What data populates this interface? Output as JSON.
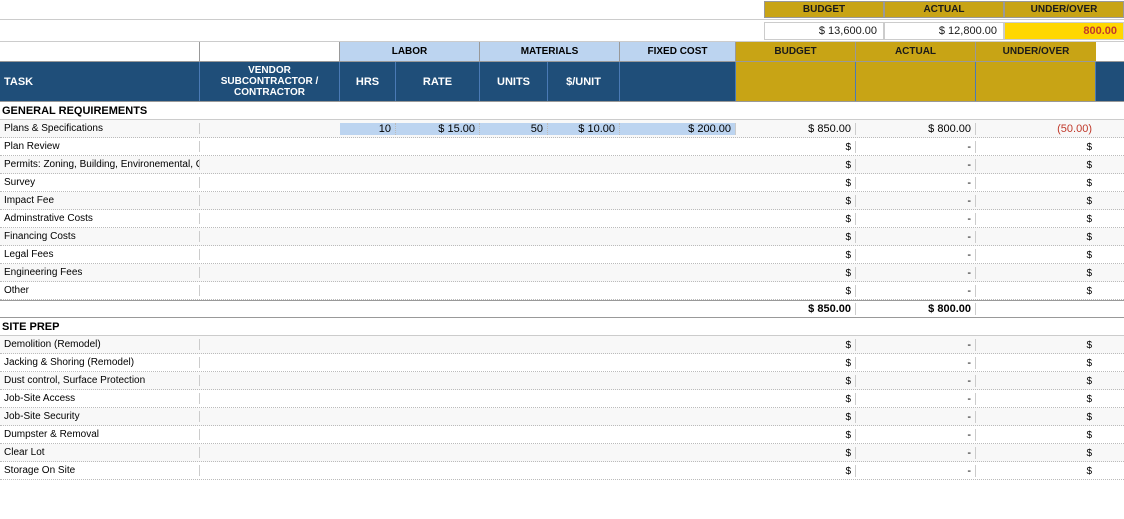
{
  "header": {
    "budget_label": "BUDGET",
    "actual_label": "ACTUAL",
    "underover_label": "UNDER/OVER",
    "budget_value": "$ 13,600.00",
    "actual_value": "$ 12,800.00",
    "underover_value": "800.00"
  },
  "col_headers": {
    "labor": "LABOR",
    "materials": "MATERIALS",
    "fixed_cost": "FIXED COST",
    "budget": "BUDGET",
    "actual": "ACTUAL",
    "underover": "UNDER/OVER"
  },
  "sub_headers": {
    "task": "TASK",
    "vendor": "VENDOR",
    "subcontractor": "SUBCONTRACTOR /",
    "contractor": "CONTRACTOR",
    "hrs": "HRS",
    "rate": "RATE",
    "units": "UNITS",
    "perunit": "$/UNIT"
  },
  "sections": [
    {
      "title": "GENERAL REQUIREMENTS",
      "rows": [
        {
          "task": "Plans & Specifications",
          "vendor": "",
          "hrs": "10",
          "rate": "$ 15.00",
          "units": "50",
          "perunit": "$ 10.00",
          "fixed": "$ 200.00",
          "budget": "$ 850.00",
          "actual": "$ 800.00",
          "underover": "(50.00)"
        },
        {
          "task": "Plan Review",
          "vendor": "",
          "hrs": "",
          "rate": "",
          "units": "",
          "perunit": "",
          "fixed": "",
          "budget": "$",
          "actual": "-",
          "underover": "$"
        },
        {
          "task": "Permits: Zoning, Building, Environemental, Other",
          "vendor": "",
          "hrs": "",
          "rate": "",
          "units": "",
          "perunit": "",
          "fixed": "",
          "budget": "$",
          "actual": "-",
          "underover": "$"
        },
        {
          "task": "Survey",
          "vendor": "",
          "hrs": "",
          "rate": "",
          "units": "",
          "perunit": "",
          "fixed": "",
          "budget": "$",
          "actual": "-",
          "underover": "$"
        },
        {
          "task": "Impact Fee",
          "vendor": "",
          "hrs": "",
          "rate": "",
          "units": "",
          "perunit": "",
          "fixed": "",
          "budget": "$",
          "actual": "-",
          "underover": "$"
        },
        {
          "task": "Adminstrative Costs",
          "vendor": "",
          "hrs": "",
          "rate": "",
          "units": "",
          "perunit": "",
          "fixed": "",
          "budget": "$",
          "actual": "-",
          "underover": "$"
        },
        {
          "task": "Financing Costs",
          "vendor": "",
          "hrs": "",
          "rate": "",
          "units": "",
          "perunit": "",
          "fixed": "",
          "budget": "$",
          "actual": "-",
          "underover": "$"
        },
        {
          "task": "Legal Fees",
          "vendor": "",
          "hrs": "",
          "rate": "",
          "units": "",
          "perunit": "",
          "fixed": "",
          "budget": "$",
          "actual": "-",
          "underover": "$"
        },
        {
          "task": "Engineering Fees",
          "vendor": "",
          "hrs": "",
          "rate": "",
          "units": "",
          "perunit": "",
          "fixed": "",
          "budget": "$",
          "actual": "-",
          "underover": "$"
        },
        {
          "task": "Other",
          "vendor": "",
          "hrs": "",
          "rate": "",
          "units": "",
          "perunit": "",
          "fixed": "",
          "budget": "$",
          "actual": "-",
          "underover": "$"
        }
      ],
      "subtotal": {
        "budget": "$ 850.00",
        "actual": "$ 800.00",
        "underover": ""
      }
    },
    {
      "title": "SITE PREP",
      "rows": [
        {
          "task": "Demolition (Remodel)",
          "vendor": "",
          "hrs": "",
          "rate": "",
          "units": "",
          "perunit": "",
          "fixed": "",
          "budget": "$",
          "actual": "-",
          "underover": "$"
        },
        {
          "task": "Jacking & Shoring (Remodel)",
          "vendor": "",
          "hrs": "",
          "rate": "",
          "units": "",
          "perunit": "",
          "fixed": "",
          "budget": "$",
          "actual": "-",
          "underover": "$"
        },
        {
          "task": "Dust control, Surface Protection",
          "vendor": "",
          "hrs": "",
          "rate": "",
          "units": "",
          "perunit": "",
          "fixed": "",
          "budget": "$",
          "actual": "-",
          "underover": "$"
        },
        {
          "task": "Job-Site Access",
          "vendor": "",
          "hrs": "",
          "rate": "",
          "units": "",
          "perunit": "",
          "fixed": "",
          "budget": "$",
          "actual": "-",
          "underover": "$"
        },
        {
          "task": "Job-Site Security",
          "vendor": "",
          "hrs": "",
          "rate": "",
          "units": "",
          "perunit": "",
          "fixed": "",
          "budget": "$",
          "actual": "-",
          "underover": "$"
        },
        {
          "task": "Dumpster & Removal",
          "vendor": "",
          "hrs": "",
          "rate": "",
          "units": "",
          "perunit": "",
          "fixed": "",
          "budget": "$",
          "actual": "-",
          "underover": "$"
        },
        {
          "task": "Clear Lot",
          "vendor": "",
          "hrs": "",
          "rate": "",
          "units": "",
          "perunit": "",
          "fixed": "",
          "budget": "$",
          "actual": "-",
          "underover": "$"
        },
        {
          "task": "Storage On Site",
          "vendor": "",
          "hrs": "",
          "rate": "",
          "units": "",
          "perunit": "",
          "fixed": "",
          "budget": "$",
          "actual": "-",
          "underover": "$"
        }
      ]
    }
  ]
}
